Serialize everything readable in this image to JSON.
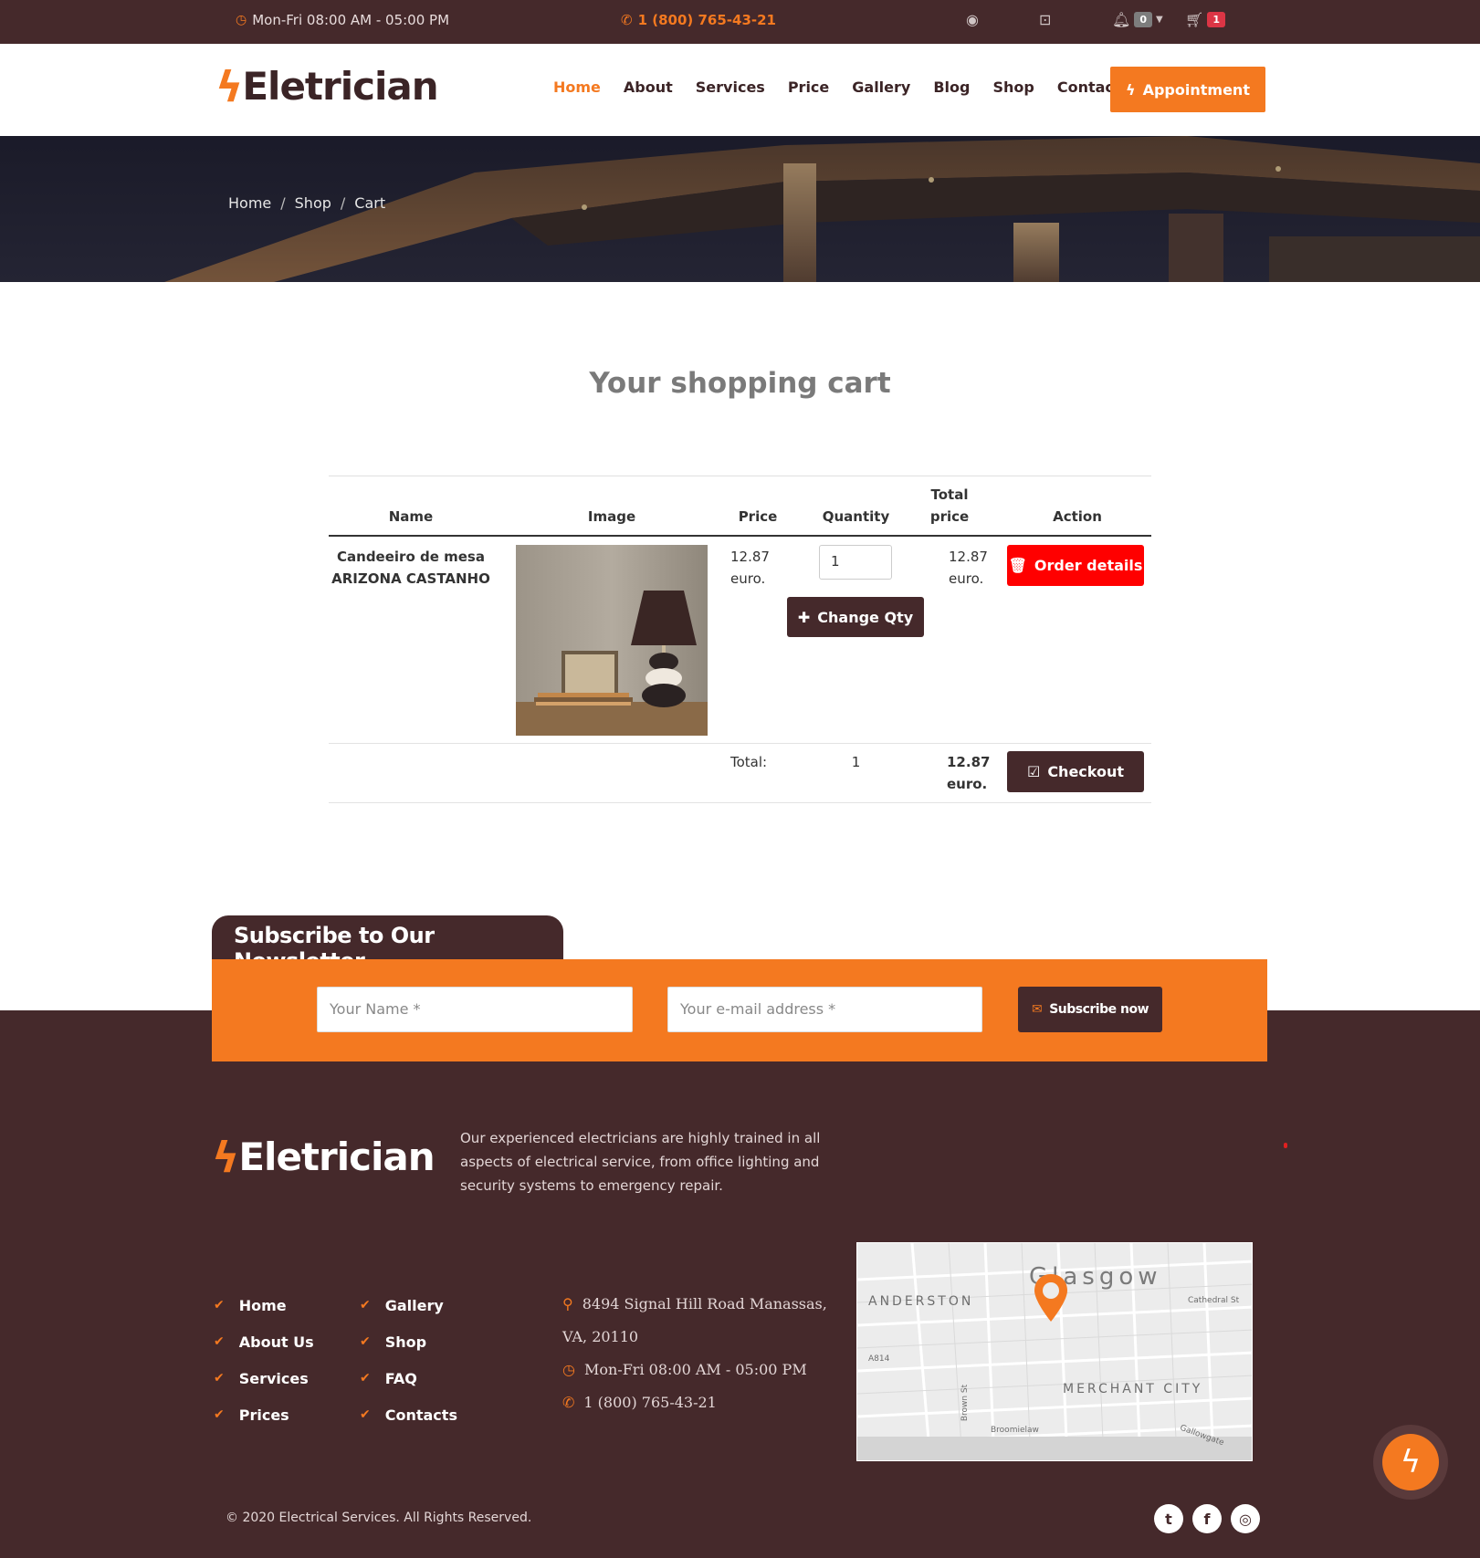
{
  "topbar": {
    "hours": "Mon-Fri 08:00 AM - 05:00 PM",
    "phone": "1 (800) 765-43-21",
    "notif_count": "0",
    "cart_count": "1"
  },
  "header": {
    "logo": "Eletrician",
    "nav": [
      "Home",
      "About",
      "Services",
      "Price",
      "Gallery",
      "Blog",
      "Shop",
      "Contact"
    ],
    "appointment": "Appointment"
  },
  "breadcrumb": [
    "Home",
    "Shop",
    "Cart"
  ],
  "main": {
    "title": "Your shopping cart",
    "columns": {
      "name": "Name",
      "image": "Image",
      "price": "Price",
      "quantity": "Quantity",
      "total_line1": "Total",
      "total_line2": "price",
      "action": "Action"
    },
    "item": {
      "name_line1": "Candeeiro de mesa",
      "name_line2": "ARIZONA CASTANHO",
      "price_value": "12.87",
      "price_unit": "euro.",
      "quantity": "1",
      "total_value": "12.87",
      "total_unit": "euro.",
      "change_qty": "Change Qty",
      "order_details": "Order details"
    },
    "totals": {
      "label": "Total:",
      "quantity": "1",
      "value": "12.87",
      "unit": "euro.",
      "checkout": "Checkout"
    }
  },
  "newsletter": {
    "title": "Subscribe to Our Newsletter",
    "name_placeholder": "Your Name *",
    "email_placeholder": "Your e-mail address *",
    "button": "Subscribe now"
  },
  "footer": {
    "logo": "Eletrician",
    "about": "Our experienced electricians are highly trained in all aspects of electrical service, from office lighting and security systems to emergency repair.",
    "links_col1": [
      "Home",
      "About Us",
      "Services",
      "Prices"
    ],
    "links_col2": [
      "Gallery",
      "Shop",
      "FAQ",
      "Contacts"
    ],
    "address_line1": "8494 Signal Hill Road Manassas,",
    "address_line2": "VA, 20110",
    "hours": "Mon-Fri 08:00 AM - 05:00 PM",
    "phone": "1 (800) 765-43-21",
    "map": {
      "city": "Glasgow",
      "anderston": "ANDERSTON",
      "merchant": "MERCHANT CITY",
      "cathedral": "Cathedral St",
      "brown": "Brown St",
      "broomielaw": "Broomielaw",
      "a814": "A814",
      "gallowgate": "Gallowgate"
    },
    "copyright": "© 2020 Electrical Services. All Rights Reserved."
  },
  "colors": {
    "accent": "#f47920",
    "dark": "#45292b",
    "danger": "#ff0000"
  }
}
